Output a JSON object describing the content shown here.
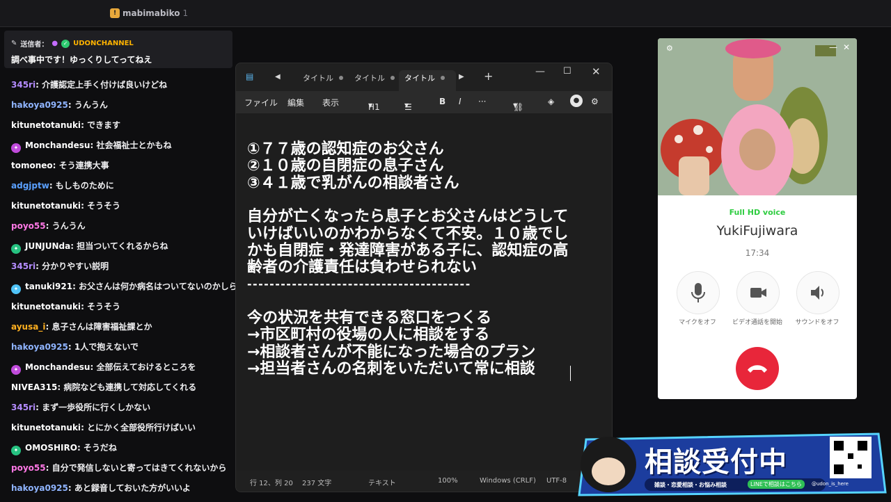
{
  "header": {
    "gift_user": "mabimabiko",
    "gift_count": "1"
  },
  "pinned": {
    "sender_label": "送信者：",
    "sender": "UDONCHANNEL",
    "message": "調べ事中です！ゆっくりしてってねえ"
  },
  "chat": [
    {
      "user": "345ri",
      "color": "#b48cff",
      "text": "介護認定上手く付けば良いけどね",
      "badge": ""
    },
    {
      "user": "hakoya0925",
      "color": "#8fb4ff",
      "text": "うんうん",
      "badge": ""
    },
    {
      "user": "kitunetotanuki",
      "color": "#ffffff",
      "text": "できます",
      "badge": ""
    },
    {
      "user": "Monchandesu",
      "color": "#ffffff",
      "text": "社会福祉士とかもね",
      "badge": "#c04bdb"
    },
    {
      "user": "tomoneo",
      "color": "#ffffff",
      "text": "そう連携大事",
      "badge": ""
    },
    {
      "user": "adgjptw",
      "color": "#5aa0ff",
      "text": "もしものために",
      "badge": ""
    },
    {
      "user": "kitunetotanuki",
      "color": "#ffffff",
      "text": "そうそう",
      "badge": ""
    },
    {
      "user": "poyo55",
      "color": "#ff78e6",
      "text": "うんうん",
      "badge": ""
    },
    {
      "user": "JUNJUNda",
      "color": "#ffffff",
      "text": "担当ついてくれるからね",
      "badge": "#26c281"
    },
    {
      "user": "345ri",
      "color": "#b48cff",
      "text": "分かりやすい説明",
      "badge": ""
    },
    {
      "user": "tanuki921",
      "color": "#ffffff",
      "text": "お父さんは何か病名はついてないのかしら",
      "badge": "#4fc3f7"
    },
    {
      "user": "kitunetotanuki",
      "color": "#ffffff",
      "text": "そうそう",
      "badge": ""
    },
    {
      "user": "ayusa_i",
      "color": "#ffb020",
      "text": "息子さんは障害福祉課とか",
      "badge": ""
    },
    {
      "user": "hakoya0925",
      "color": "#8fb4ff",
      "text": "1人で抱えないで",
      "badge": ""
    },
    {
      "user": "Monchandesu",
      "color": "#ffffff",
      "text": "全部伝えておけるところを",
      "badge": "#c04bdb"
    },
    {
      "user": "NIVEA315",
      "color": "#ffffff",
      "text": "病院なども連携して対応してくれる",
      "badge": ""
    },
    {
      "user": "345ri",
      "color": "#b48cff",
      "text": "まず一歩役所に行くしかない",
      "badge": ""
    },
    {
      "user": "kitunetotanuki",
      "color": "#ffffff",
      "text": "とにかく全部役所行けばいい",
      "badge": ""
    },
    {
      "user": "OMOSHIRO",
      "color": "#ffffff",
      "text": "そうだね",
      "badge": "#26c281"
    },
    {
      "user": "poyo55",
      "color": "#ff78e6",
      "text": "自分で発信しないと寄ってはきてくれないから",
      "badge": ""
    },
    {
      "user": "hakoya0925",
      "color": "#8fb4ff",
      "text": "あと録音しておいた方がいいよ",
      "badge": ""
    }
  ],
  "notepad": {
    "tabs": [
      "タイトル",
      "タイトル",
      "タイトル"
    ],
    "menu": {
      "file": "ファイル",
      "edit": "編集",
      "view": "表示",
      "heading": "H1"
    },
    "lines": [
      "①７７歳の認知症のお父さん",
      "②１０歳の自閉症の息子さん",
      "③４１歳で乳がんの相談者さん",
      "",
      "自分が亡くなったら息子とお父さんはどうして",
      "いけばいいのかわからなくて不安。１０歳でし",
      "かも自閉症・発達障害がある子に、認知症の高",
      "齢者の介護責任は負わせられない",
      "----------------------------------------",
      "",
      "今の状況を共有できる窓口をつくる",
      "→市区町村の役場の人に相談をする",
      "→相談者さんが不能になった場合のプラン",
      "→担当者さんの名刺をいただいて常に相談"
    ],
    "status": {
      "position": "行 12、列 20",
      "chars": "237 文字",
      "mode": "テキスト",
      "zoom": "100%",
      "eol": "Windows (CRLF)",
      "encoding": "UTF-8"
    }
  },
  "call": {
    "quality": "Full HD voice",
    "name": "YukiFujiwara",
    "time": "17:34",
    "buttons": [
      "マイクをオフ",
      "ビデオ通話を開始",
      "サウンドをオフ"
    ]
  },
  "banner": {
    "title": "相談受付中",
    "subtitle": "雑談・恋愛相談・お悩み相談",
    "line_text": "LINEで相談はこちら",
    "handle": "@udon_is_here"
  }
}
